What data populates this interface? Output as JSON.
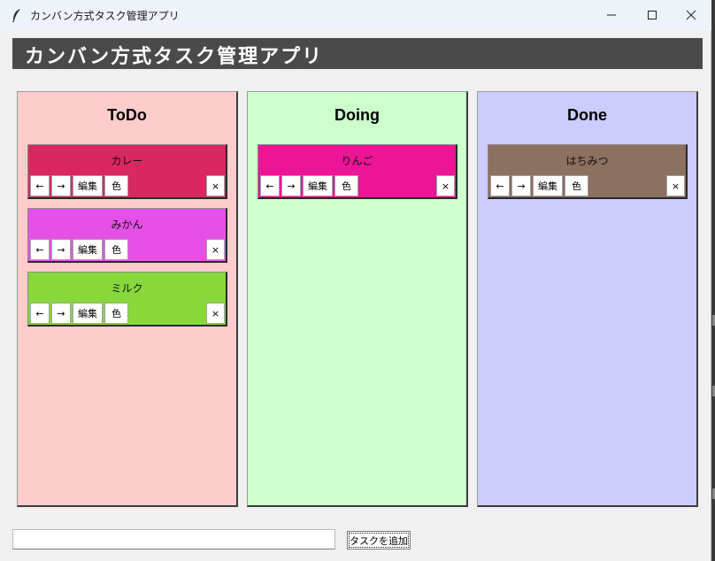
{
  "window": {
    "title": "カンバン方式タスク管理アプリ"
  },
  "header": {
    "title": "カンバン方式タスク管理アプリ"
  },
  "columns": [
    {
      "title": "ToDo",
      "bg_color": "#ffcccc",
      "cards": [
        {
          "title": "カレー",
          "color": "#d9285f"
        },
        {
          "title": "みかん",
          "color": "#e650e6"
        },
        {
          "title": "ミルク",
          "color": "#88d83c"
        }
      ]
    },
    {
      "title": "Doing",
      "bg_color": "#ccffcc",
      "cards": [
        {
          "title": "りんご",
          "color": "#ee1496"
        }
      ]
    },
    {
      "title": "Done",
      "bg_color": "#ccccff",
      "cards": [
        {
          "title": "はちみつ",
          "color": "#8c7060"
        }
      ]
    }
  ],
  "card_buttons": {
    "left": "←",
    "right": "→",
    "edit": "編集",
    "color": "色",
    "delete": "×"
  },
  "footer": {
    "input_value": "",
    "add_button": "タスクを追加"
  }
}
